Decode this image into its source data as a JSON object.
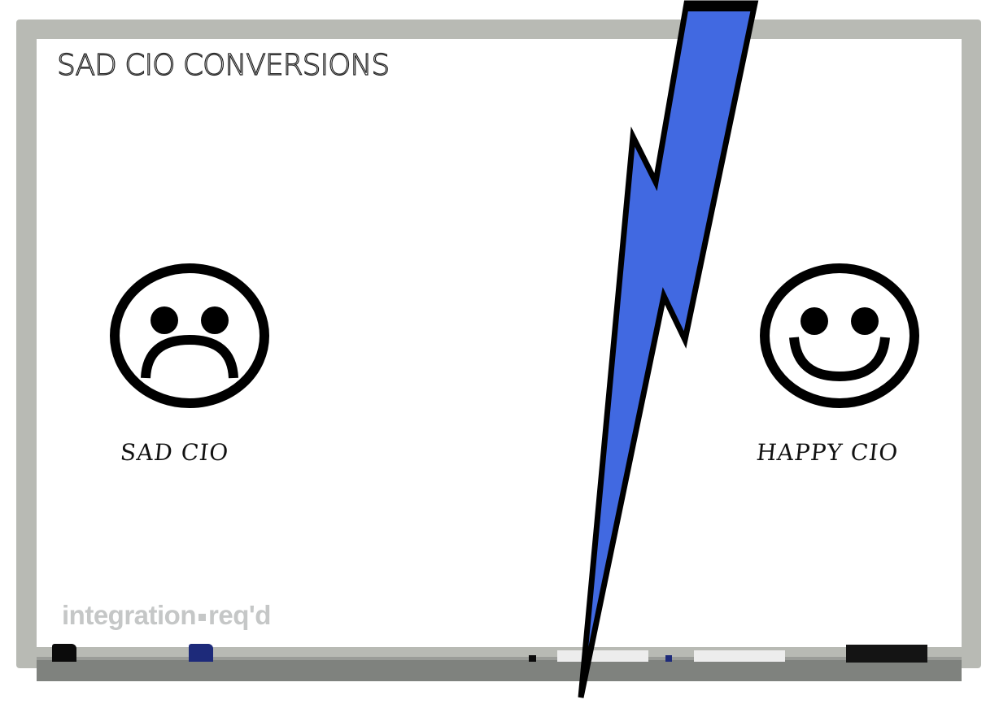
{
  "board": {
    "title": "SAD CIO CONVERSIONS",
    "left_caption": "SAD CIO",
    "right_caption": "HAPPY CIO"
  },
  "faces": {
    "left_icon": "frowning-face-icon",
    "right_icon": "smiling-face-icon"
  },
  "logo": {
    "text_left": "integration",
    "text_right": "req'd"
  },
  "bolt_icon": "lightning-bolt-icon",
  "colors": {
    "bolt_fill": "#4169e1",
    "outline": "#000000",
    "frame": "#b8bab4",
    "tray": "#7f827e",
    "marker_blue": "#1d2a7a",
    "logo_gray": "#c5c7c7"
  }
}
